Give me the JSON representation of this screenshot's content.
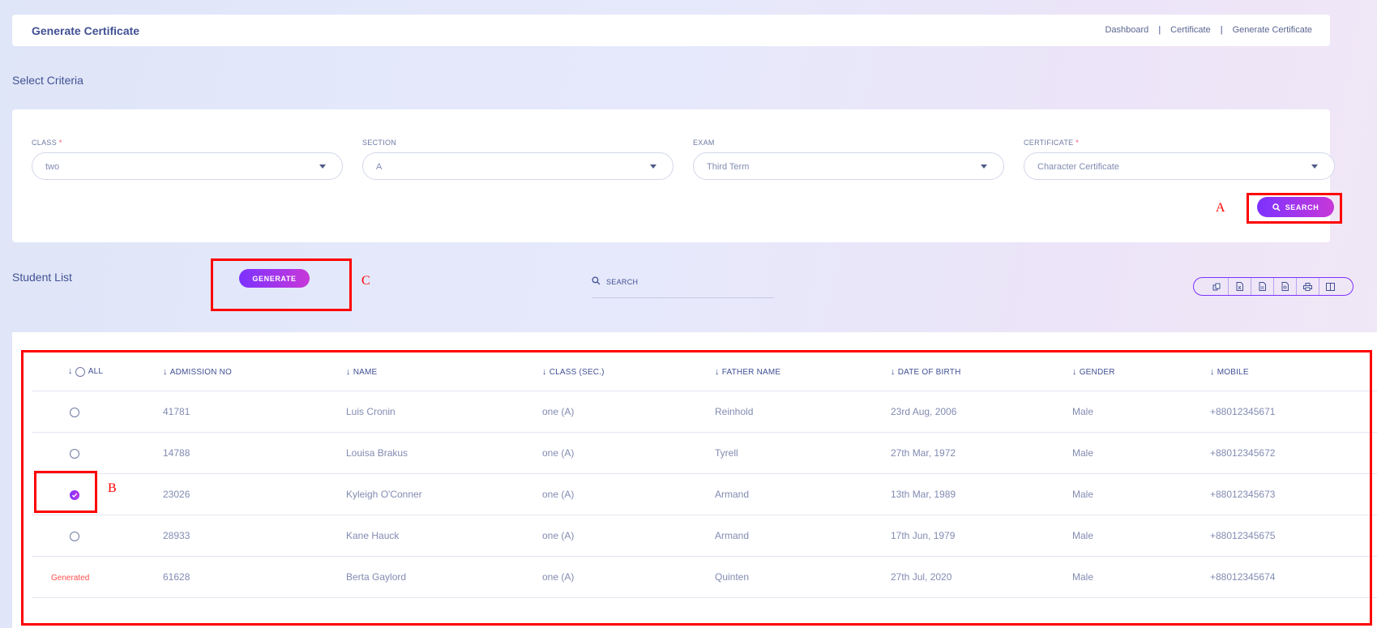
{
  "header": {
    "title": "Generate Certificate",
    "breadcrumb": [
      "Dashboard",
      "Certificate",
      "Generate Certificate"
    ],
    "separator": "|"
  },
  "criteria": {
    "title": "Select Criteria",
    "fields": [
      {
        "label": "CLASS",
        "required": "*",
        "value": "two"
      },
      {
        "label": "SECTION",
        "required": "",
        "value": "A"
      },
      {
        "label": "EXAM",
        "required": "",
        "value": "Third Term"
      },
      {
        "label": "CERTIFICATE",
        "required": "*",
        "value": "Character Certificate"
      }
    ],
    "search_button": "SEARCH"
  },
  "student_list": {
    "title": "Student List",
    "generate_button": "GENERATE",
    "search_placeholder": "SEARCH",
    "tools": [
      "copy-icon",
      "excel-icon",
      "csv-icon",
      "pdf-icon",
      "print-icon",
      "columns-icon"
    ]
  },
  "table": {
    "columns": [
      "ALL",
      "ADMISSION NO",
      "NAME",
      "CLASS (SEC.)",
      "FATHER NAME",
      "DATE OF BIRTH",
      "GENDER",
      "MOBILE"
    ],
    "rows": [
      {
        "status": "radio",
        "admission": "41781",
        "name": "Luis Cronin",
        "class": "one (A)",
        "father": "Reinhold",
        "dob": "23rd Aug, 2006",
        "gender": "Male",
        "mobile": "+88012345671"
      },
      {
        "status": "radio",
        "admission": "14788",
        "name": "Louisa Brakus",
        "class": "one (A)",
        "father": "Tyrell",
        "dob": "27th Mar, 1972",
        "gender": "Male",
        "mobile": "+88012345672"
      },
      {
        "status": "checked",
        "admission": "23026",
        "name": "Kyleigh O'Conner",
        "class": "one (A)",
        "father": "Armand",
        "dob": "13th Mar, 1989",
        "gender": "Male",
        "mobile": "+88012345673"
      },
      {
        "status": "radio",
        "admission": "28933",
        "name": "Kane Hauck",
        "class": "one (A)",
        "father": "Armand",
        "dob": "17th Jun, 1979",
        "gender": "Male",
        "mobile": "+88012345675"
      },
      {
        "status": "Generated",
        "admission": "61628",
        "name": "Berta Gaylord",
        "class": "one (A)",
        "father": "Quinten",
        "dob": "27th Jul, 2020",
        "gender": "Male",
        "mobile": "+88012345674"
      }
    ]
  },
  "annotations": {
    "a": "A",
    "b": "B",
    "c": "C"
  },
  "colors": {
    "accent_start": "#7c32ff",
    "accent_end": "#c738d8",
    "text": "#415094",
    "annotation": "#ff0000",
    "generated": "#ff4d4d"
  }
}
